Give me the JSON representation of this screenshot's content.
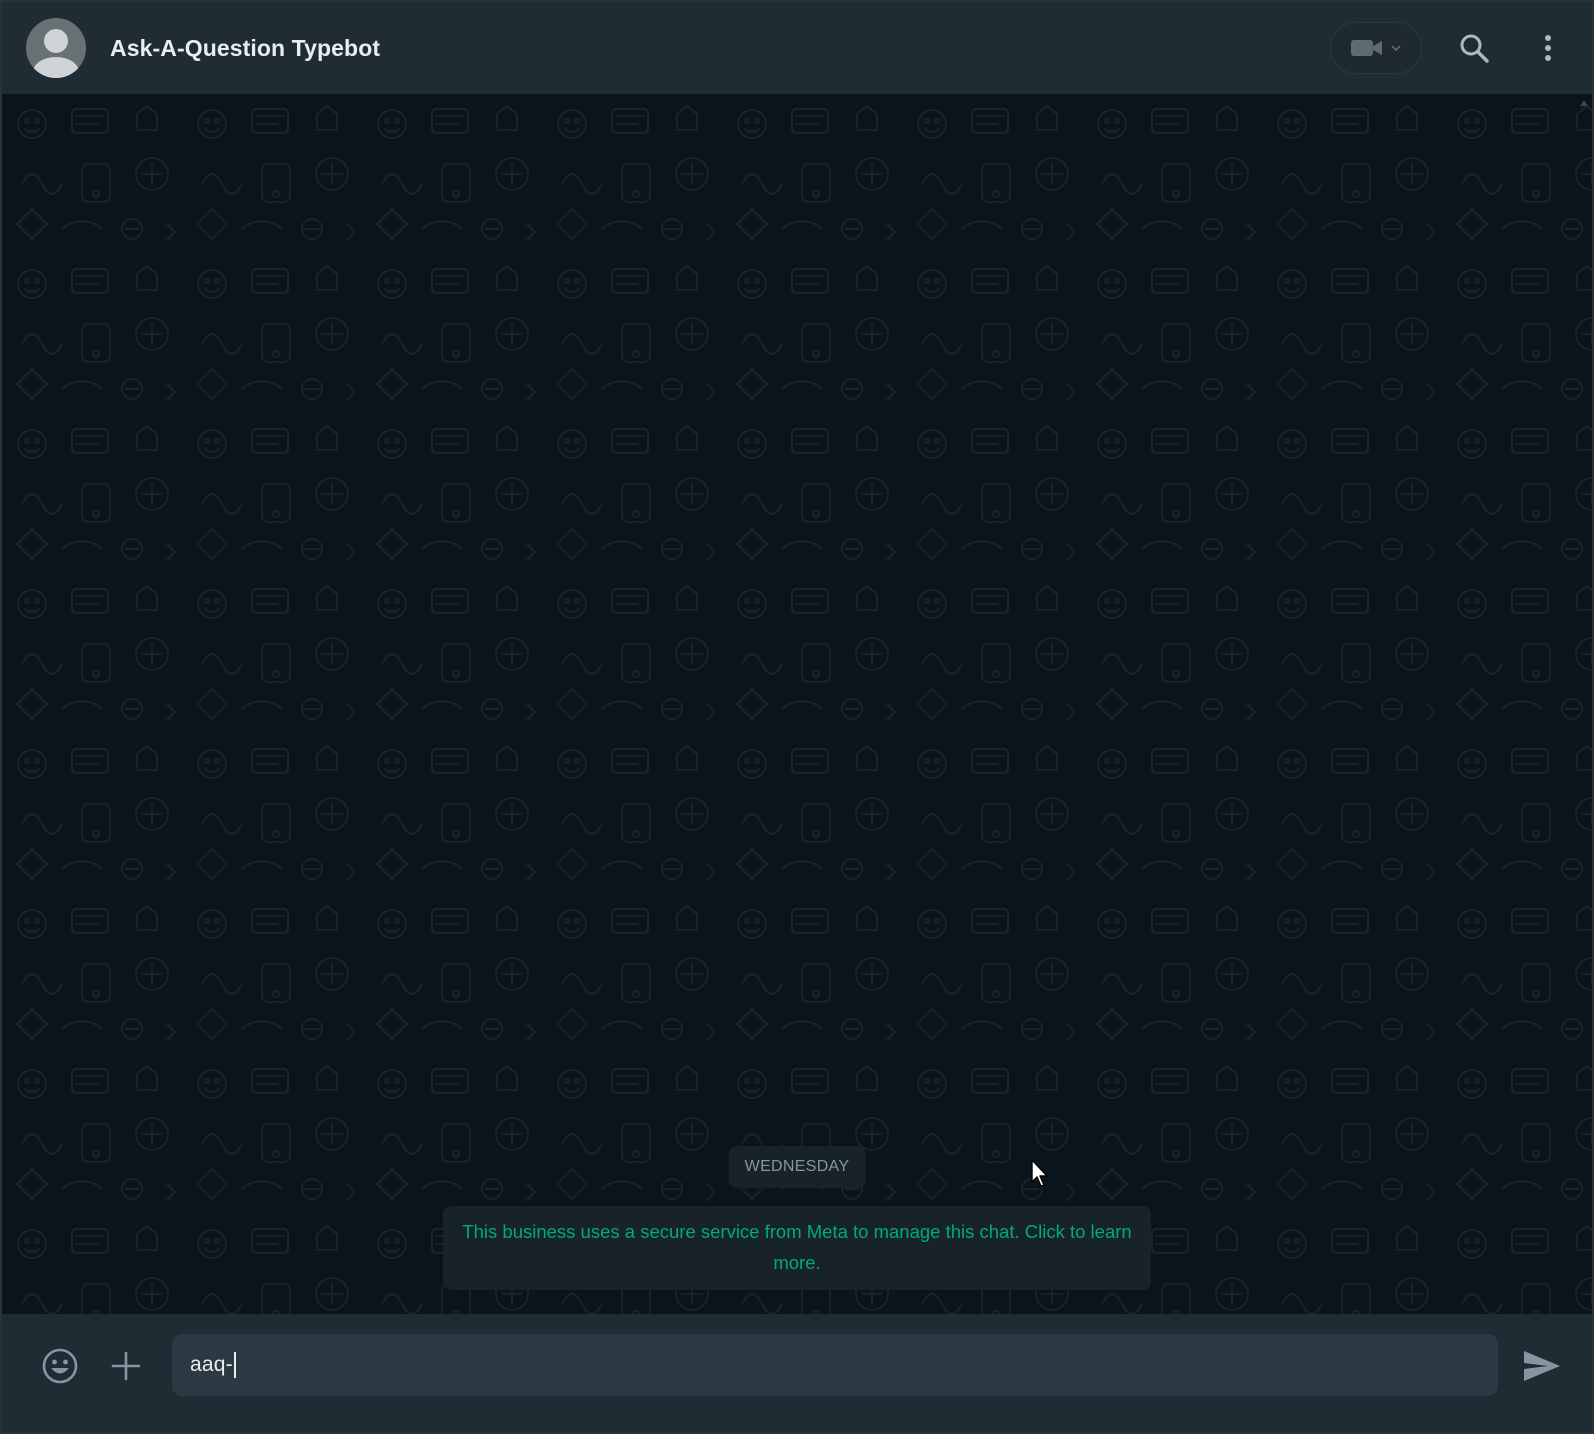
{
  "header": {
    "title": "Ask-A-Question Typebot",
    "avatar_icon": "default-avatar-icon",
    "video_icon": "video-camera-icon",
    "video_dropdown_icon": "chevron-down-icon",
    "search_icon": "search-icon",
    "menu_icon": "more-vertical-icon"
  },
  "chat": {
    "date_label": "WEDNESDAY",
    "system_notice": "This business uses a secure service from Meta to manage this chat. Click to learn more."
  },
  "footer": {
    "emoji_icon": "emoji-icon",
    "attach_icon": "plus-icon",
    "message_value": "aaq-",
    "send_icon": "send-icon"
  },
  "colors": {
    "header_bg": "#202c33",
    "chat_bg": "#0b141a",
    "notice_text": "#00a884",
    "input_bg": "#2a3942",
    "primary_text": "#e9edef",
    "secondary_text": "#8696a0"
  }
}
